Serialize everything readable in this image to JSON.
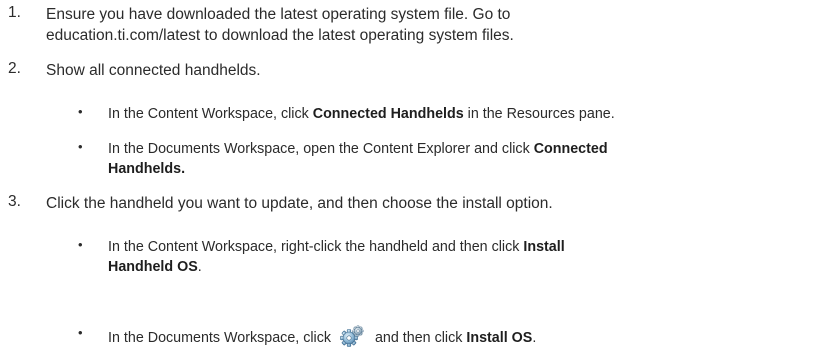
{
  "steps": [
    {
      "number": "1.",
      "line1": "Ensure you have downloaded the latest operating system file. Go to",
      "line2": "education.ti.com/latest to download the latest operating system files."
    },
    {
      "number": "2.",
      "line1": "Show all connected handhelds."
    },
    {
      "number": "3.",
      "line1": "Click the handheld you want to update, and then choose the install option."
    }
  ],
  "bullets": {
    "b1": {
      "symbol": "•",
      "pre": "In the Content Workspace, click ",
      "bold": "Connected Handhelds",
      "post": " in the Resources pane."
    },
    "b2": {
      "symbol": "•",
      "pre": "In the Documents Workspace, open the Content Explorer and click ",
      "bold1": "Connected",
      "bold2": "Handhelds."
    },
    "b3": {
      "symbol": "•",
      "pre": "In the Content Workspace, right-click the handheld and then click ",
      "bold1": "Install",
      "bold2": "Handheld OS",
      "post": "."
    },
    "b4": {
      "symbol": "•",
      "pre": "In the Documents Workspace, click ",
      "icon": "settings-gear-icon",
      "mid": " and then click ",
      "bold": "Install OS",
      "post": "."
    }
  }
}
